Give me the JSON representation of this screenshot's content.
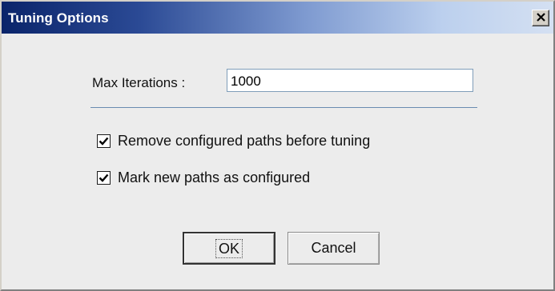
{
  "window": {
    "title": "Tuning Options",
    "close_symbol": "✕"
  },
  "form": {
    "max_iterations_label": "Max Iterations :",
    "max_iterations_value": "1000"
  },
  "options": [
    {
      "label": "Remove configured paths before tuning",
      "checked": true
    },
    {
      "label": "Mark new paths as configured",
      "checked": true
    }
  ],
  "buttons": {
    "ok_label": "OK",
    "cancel_label": "Cancel"
  },
  "colors": {
    "title_start": "#0a246a",
    "title_end": "#d4e0f2",
    "separator": "#6a8bb0",
    "input_border": "#7f9db9"
  }
}
